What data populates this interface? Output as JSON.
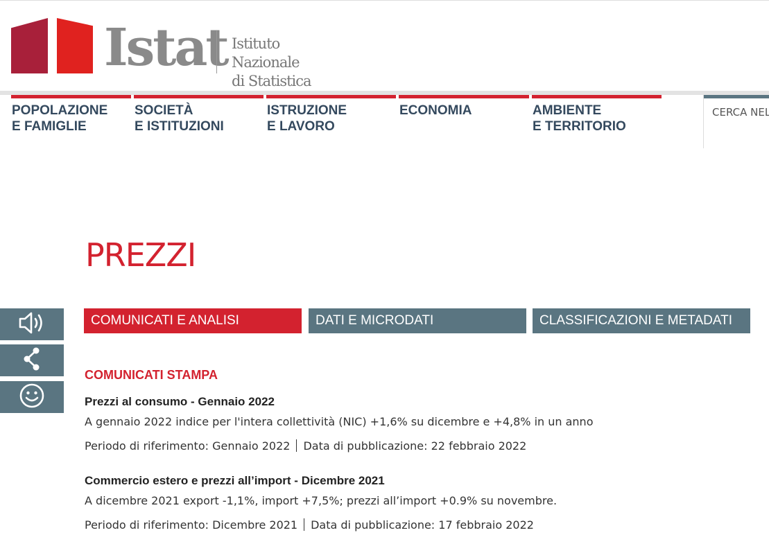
{
  "header": {
    "logo_text": "Istat",
    "logo_subtitle_line1": "Istituto Nazionale",
    "logo_subtitle_line2": "di Statistica"
  },
  "nav": {
    "items": [
      {
        "label": "POPOLAZIONE\nE FAMIGLIE"
      },
      {
        "label": "SOCIETÀ\nE ISTITUZIONI"
      },
      {
        "label": "ISTRUZIONE\nE LAVORO"
      },
      {
        "label": "ECONOMIA"
      },
      {
        "label": "AMBIENTE\nE TERRITORIO"
      }
    ],
    "search_label": "CERCA NEL"
  },
  "page": {
    "title": "PREZZI"
  },
  "tools": {
    "items": [
      "speaker-icon",
      "share-icon",
      "smiley-icon"
    ]
  },
  "tabs": [
    {
      "label": "COMUNICATI E ANALISI",
      "active": true,
      "color": "#d3222f"
    },
    {
      "label": "DATI E MICRODATI",
      "active": false,
      "color": "#5a7581"
    },
    {
      "label": "CLASSIFICAZIONI E METADATI",
      "active": false,
      "color": "#5a7581"
    }
  ],
  "content": {
    "section_title": "COMUNICATI STAMPA",
    "items": [
      {
        "title": "Prezzi al consumo - Gennaio 2022",
        "description": "A gennaio 2022 indice per l'intera collettività (NIC) +1,6% su dicembre e +4,8% in un anno",
        "period": "Periodo di riferimento: Gennaio 2022",
        "published": "Data di pubblicazione: 22 febbraio 2022"
      },
      {
        "title": "Commercio estero e prezzi all’import - Dicembre 2021",
        "description": "A dicembre 2021 export -1,1%, import +7,5%; prezzi all’import +0.9% su novembre.",
        "period": "Periodo di riferimento: Dicembre 2021",
        "published": "Data di pubblicazione: 17 febbraio 2022"
      }
    ]
  },
  "colors": {
    "accent_red": "#d3222f",
    "slate": "#5a7581",
    "nav_text": "#34495e"
  }
}
